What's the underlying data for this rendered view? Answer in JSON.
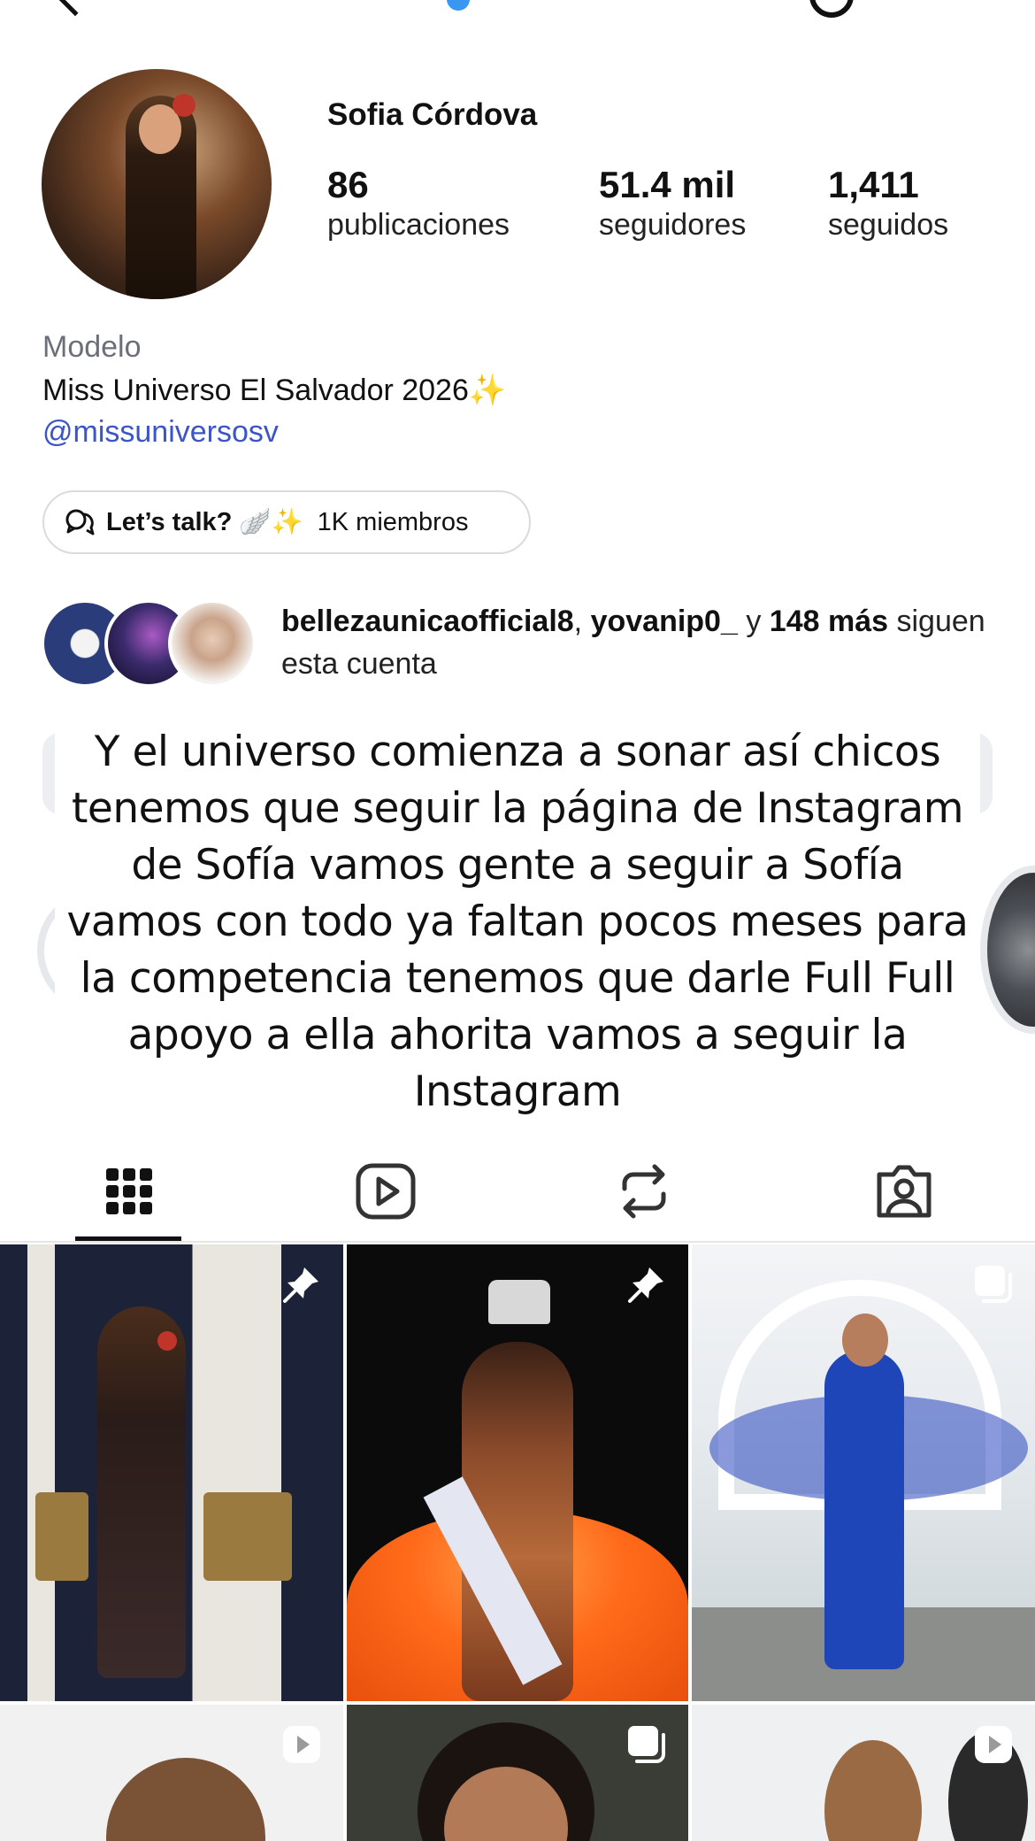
{
  "profile": {
    "display_name": "Sofia Córdova",
    "stats": [
      {
        "value": "86",
        "label": "publicaciones"
      },
      {
        "value": "51.4 mil",
        "label": "seguidores"
      },
      {
        "value": "1,411",
        "label": "seguidos"
      }
    ],
    "bio": {
      "category": "Modelo",
      "line": "Miss Universo El Salvador 2026✨",
      "link": "@missuniversosv"
    }
  },
  "channel": {
    "title": "Let’s talk? 🪽✨",
    "members": "1K miembros",
    "icon": "chat-bubbles-icon"
  },
  "followed_by": {
    "user1": "bellezaunicaofficial8",
    "sep": ", ",
    "user2": "yovanip0_",
    "and": " y ",
    "more": "148 más",
    "suffix": " siguen esta cuenta"
  },
  "caption": {
    "text": "Y el universo comienza a sonar así chicos tenemos que seguir la página de Instagram de Sofía vamos gente a seguir a Sofía vamos con todo ya faltan pocos meses para la competencia tenemos que darle Full Full apoyo a ella ahorita vamos a seguir la Instagram"
  },
  "tabs": [
    {
      "name": "posts",
      "icon": "grid-icon",
      "active": true
    },
    {
      "name": "reels",
      "icon": "reels-icon",
      "active": false
    },
    {
      "name": "reposts",
      "icon": "repost-icon",
      "active": false
    },
    {
      "name": "tagged",
      "icon": "tagged-person-icon",
      "active": false
    }
  ],
  "grid_badges": [
    "pin-icon",
    "pin-icon",
    "carousel-icon",
    "reel-play-icon",
    "carousel-icon",
    "reel-play-icon"
  ],
  "colors": {
    "link": "#3b55c9",
    "category": "#6b6f78",
    "text": "#111111",
    "border": "#dbdbdb"
  }
}
